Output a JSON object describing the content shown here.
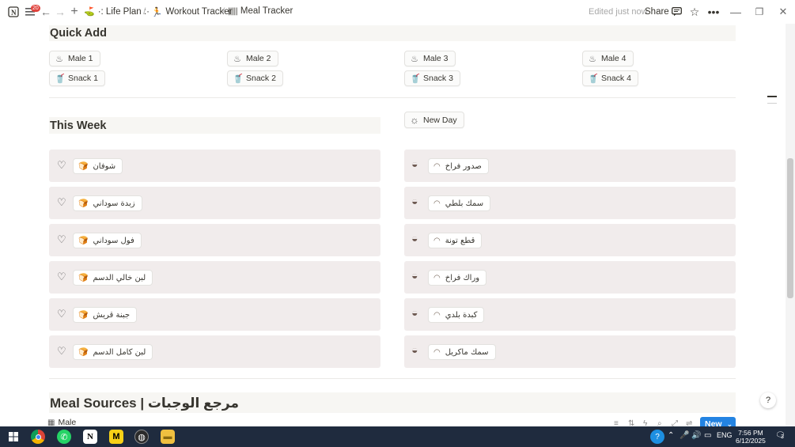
{
  "topbar": {
    "badge_count": "20",
    "breadcrumbs": [
      {
        "icon": "mountain-flag-icon",
        "label": "·: Life Plan :·"
      },
      {
        "icon": "runner-icon",
        "label": "Workout Tracker"
      },
      {
        "icon": "barcode-icon",
        "label": "Meal Tracker"
      }
    ],
    "edited_text": "Edited just now",
    "share_label": "Share"
  },
  "quick_add": {
    "title": "Quick Add",
    "buttons": [
      {
        "label": "Male 1",
        "icon": "cooking-pot-icon"
      },
      {
        "label": "Male 2",
        "icon": "cooking-pot-icon"
      },
      {
        "label": "Male 3",
        "icon": "cooking-pot-icon"
      },
      {
        "label": "Male 4",
        "icon": "cooking-pot-icon"
      },
      {
        "label": "Snack 1",
        "icon": "cup-icon"
      },
      {
        "label": "Snack 2",
        "icon": "cup-icon"
      },
      {
        "label": "Snack 3",
        "icon": "cup-icon"
      },
      {
        "label": "Snack 4",
        "icon": "cup-icon"
      }
    ]
  },
  "this_week": {
    "title": "This Week",
    "new_day_label": "New Day",
    "left_items": [
      "شوفان",
      "زبدة سوداني",
      "فول سوداني",
      "لبن خالي الدسم",
      "جبنة قريش",
      "لبن كامل الدسم"
    ],
    "right_items": [
      "صدور فراخ",
      "سمك بلطي",
      "قطع تونة",
      "وراك فراخ",
      "كبدة بلدي",
      "سمك ماكريل"
    ]
  },
  "meal_sources": {
    "title": "Meal Sources | مرجع الوجبات",
    "view_tab": "Male",
    "new_label": "New"
  },
  "taskbar": {
    "lang": "ENG",
    "time": "7:56 PM",
    "date": "6/12/2025",
    "notif_count": "3"
  },
  "colors": {
    "accent": "#2383e2",
    "card_bg": "#f1ecec",
    "band_bg": "#f7f6f3",
    "taskbar_bg": "#1f2b3e"
  }
}
